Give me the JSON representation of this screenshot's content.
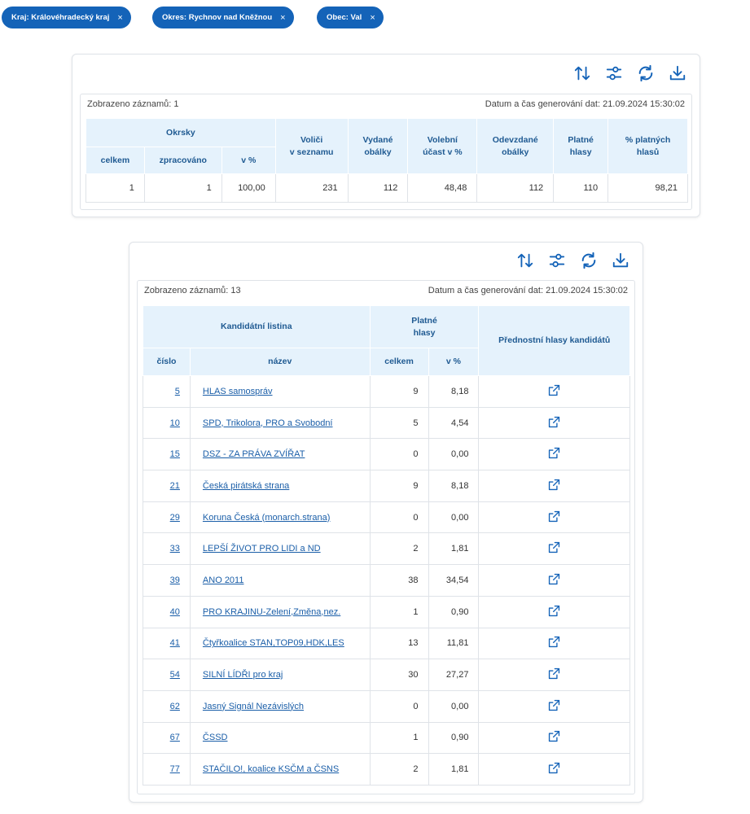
{
  "filters": [
    {
      "label": "Kraj: Královéhradecký kraj",
      "remove": "×"
    },
    {
      "label": "Okres: Rychnov nad Kněžnou",
      "remove": "×"
    },
    {
      "label": "Obec: Val",
      "remove": "×"
    }
  ],
  "colors": {
    "accent": "#1463b8",
    "header_bg": "#e5f2fc",
    "header_text": "#1f5a92",
    "link": "#1a5ea8"
  },
  "toolbar_icons": [
    "sort-icon",
    "filter-settings-icon",
    "refresh-icon",
    "download-icon"
  ],
  "summary": {
    "records": "Zobrazeno záznamů: 1",
    "generated": "Datum a čas generování dat: 21.09.2024 15:30:02",
    "headers": {
      "okrsky": "Okrsky",
      "celkem": "celkem",
      "zpracovano": "zpracováno",
      "v_pct": "v %",
      "volici_1": "Voliči",
      "volici_2": "v seznamu",
      "vydane_1": "Vydané",
      "vydane_2": "obálky",
      "ucast_1": "Volební",
      "ucast_2": "účast v %",
      "odevzdane_1": "Odevzdané",
      "odevzdane_2": "obálky",
      "platne_1": "Platné",
      "platne_2": "hlasy",
      "pct_platnych_1": "% platných",
      "pct_platnych_2": "hlasů"
    },
    "row": {
      "celkem": "1",
      "zpracovano": "1",
      "v_pct": "100,00",
      "volici": "231",
      "vydane": "112",
      "ucast": "48,48",
      "odevzdane": "112",
      "platne": "110",
      "pct_platnych": "98,21"
    }
  },
  "parties": {
    "records": "Zobrazeno záznamů: 13",
    "generated": "Datum a čas generování dat: 21.09.2024 15:30:02",
    "headers": {
      "listina": "Kandidátní listina",
      "platne_1": "Platné",
      "platne_2": "hlasy",
      "prednostni": "Přednostní hlasy kandidátů",
      "cislo": "číslo",
      "nazev": "název",
      "celkem": "celkem",
      "v_pct": "v %"
    },
    "rows": [
      {
        "cislo": "5",
        "nazev": "HLAS samospráv",
        "celkem": "9",
        "pct": "8,18"
      },
      {
        "cislo": "10",
        "nazev": "SPD, Trikolora, PRO a Svobodní",
        "celkem": "5",
        "pct": "4,54"
      },
      {
        "cislo": "15",
        "nazev": "DSZ - ZA PRÁVA ZVÍŘAT",
        "celkem": "0",
        "pct": "0,00"
      },
      {
        "cislo": "21",
        "nazev": "Česká pirátská strana",
        "celkem": "9",
        "pct": "8,18"
      },
      {
        "cislo": "29",
        "nazev": "Koruna Česká (monarch.strana)",
        "celkem": "0",
        "pct": "0,00"
      },
      {
        "cislo": "33",
        "nazev": "LEPŠÍ ŽIVOT PRO LIDI a ND",
        "celkem": "2",
        "pct": "1,81"
      },
      {
        "cislo": "39",
        "nazev": "ANO 2011",
        "celkem": "38",
        "pct": "34,54"
      },
      {
        "cislo": "40",
        "nazev": "PRO KRAJINU-Zelení,Změna,nez.",
        "celkem": "1",
        "pct": "0,90"
      },
      {
        "cislo": "41",
        "nazev": "Čtyřkoalice STAN,TOP09,HDK,LES",
        "celkem": "13",
        "pct": "11,81"
      },
      {
        "cislo": "54",
        "nazev": "SILNÍ LÍDŘI pro kraj",
        "celkem": "30",
        "pct": "27,27"
      },
      {
        "cislo": "62",
        "nazev": "Jasný Signál Nezávislých",
        "celkem": "0",
        "pct": "0,00"
      },
      {
        "cislo": "67",
        "nazev": "ČSSD",
        "celkem": "1",
        "pct": "0,90"
      },
      {
        "cislo": "77",
        "nazev": "STAČILO!, koalice KSČM a ČSNS",
        "celkem": "2",
        "pct": "1,81"
      }
    ]
  }
}
